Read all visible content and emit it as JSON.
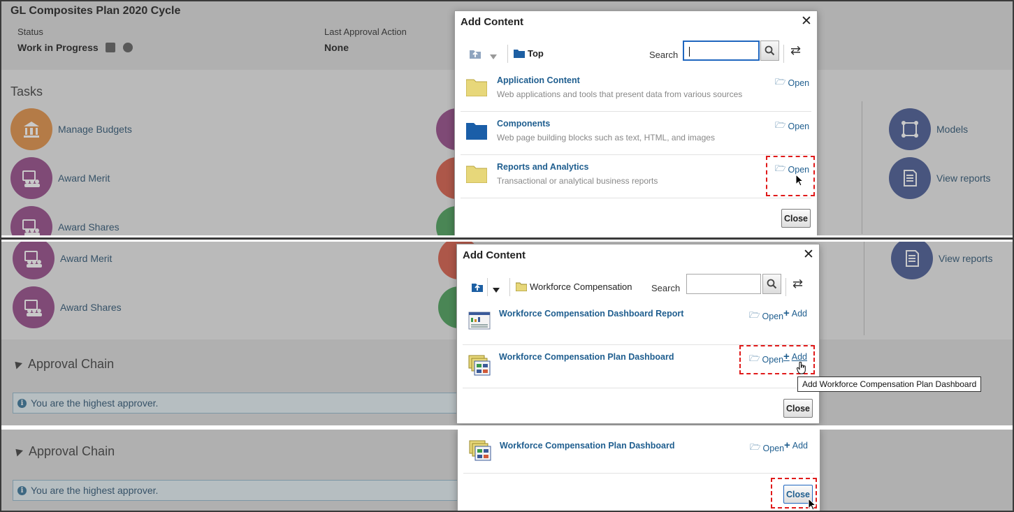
{
  "app": {
    "title": "GL Composites Plan 2020 Cycle",
    "status_label": "Status",
    "status_value": "Work in Progress",
    "last_action_label": "Last Approval Action",
    "last_action_value": "None"
  },
  "tasks": {
    "header": "Tasks",
    "left": [
      {
        "label": "Manage Budgets",
        "color": "#e0893a",
        "icon": "bank-icon"
      },
      {
        "label": "Award Merit",
        "color": "#8f3f82",
        "icon": "people-icon"
      },
      {
        "label": "Award Shares",
        "color": "#8f3f82",
        "icon": "people-icon"
      }
    ],
    "right": [
      {
        "label": "Models",
        "color": "#3c4f8d",
        "icon": "model-icon"
      },
      {
        "label": "View reports",
        "color": "#3c4f8d",
        "icon": "report-icon"
      }
    ],
    "middle_colors": [
      "#8f3f82",
      "#d5533d",
      "#3f9a4f"
    ]
  },
  "approval": {
    "header": "Approval Chain",
    "message": "You are the highest approver."
  },
  "dialog1": {
    "title": "Add Content",
    "crumb": "Top",
    "search_label": "Search",
    "search_value": "",
    "rows": [
      {
        "title": "Application Content",
        "desc": "Web applications and tools that present data from various sources",
        "open": "Open",
        "folder": "yellow"
      },
      {
        "title": "Components",
        "desc": "Web page building blocks such as text, HTML, and images",
        "open": "Open",
        "folder": "blue"
      },
      {
        "title": "Reports and Analytics",
        "desc": "Transactional or analytical business reports",
        "open": "Open",
        "folder": "yellow"
      }
    ],
    "close": "Close"
  },
  "dialog2": {
    "title": "Add Content",
    "crumb": "Workforce Compensation",
    "search_label": "Search",
    "search_value": "",
    "rows": [
      {
        "title": "Workforce Compensation Dashboard Report",
        "open": "Open",
        "add": "Add"
      },
      {
        "title": "Workforce Compensation Plan Dashboard",
        "open": "Open",
        "add": "Add"
      }
    ],
    "tooltip": "Add Workforce Compensation Plan Dashboard",
    "close": "Close"
  },
  "dialog3": {
    "row": {
      "title": "Workforce Compensation Plan Dashboard",
      "open": "Open",
      "add": "Add"
    },
    "close": "Close"
  },
  "colors": {
    "link": "#1f5e8f",
    "highlight": "#e01a1a",
    "focus": "#1f66bf"
  }
}
